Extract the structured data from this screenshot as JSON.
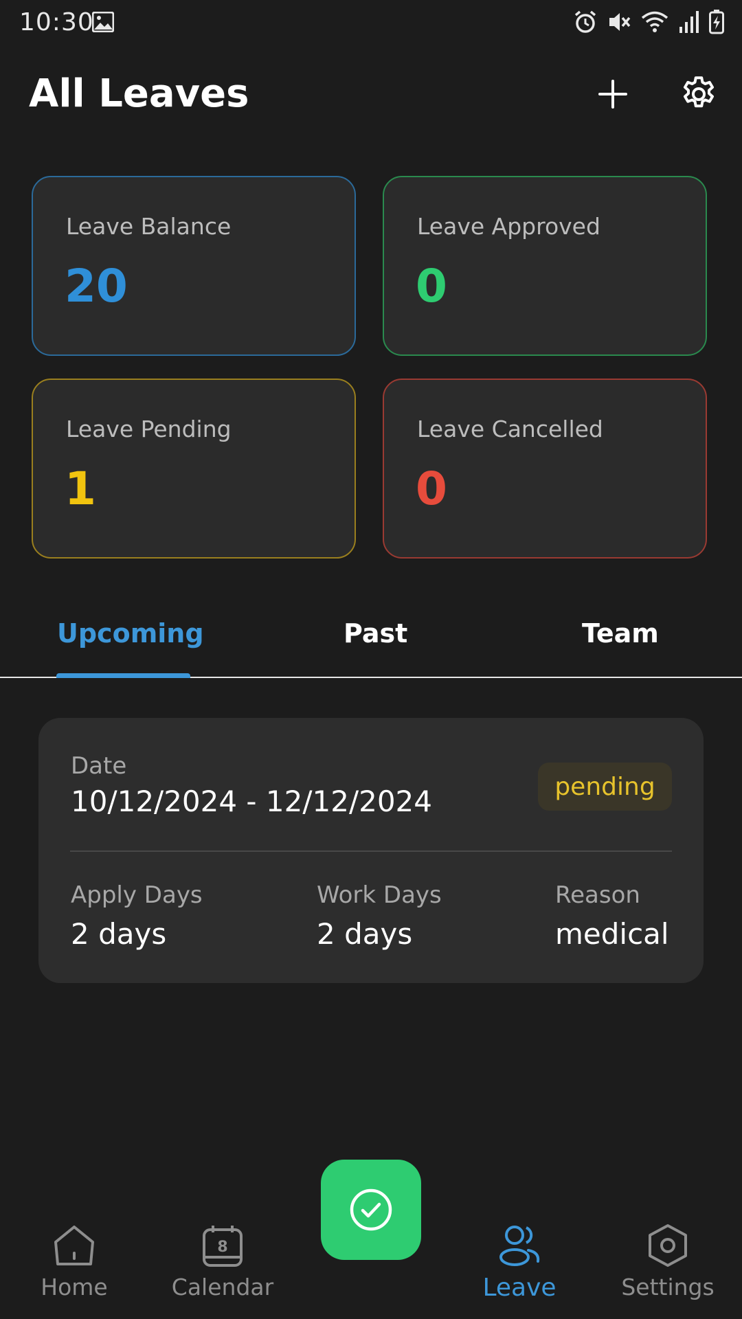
{
  "status_bar": {
    "time": "10:30"
  },
  "header": {
    "title": "All Leaves"
  },
  "stats": [
    {
      "label": "Leave Balance",
      "value": "20",
      "color": "#2f8fd8",
      "border": "#2b6a9a"
    },
    {
      "label": "Leave Approved",
      "value": "0",
      "color": "#2ecc71",
      "border": "#2a8a4e"
    },
    {
      "label": "Leave Pending",
      "value": "1",
      "color": "#f1c40f",
      "border": "#9a7f1e"
    },
    {
      "label": "Leave Cancelled",
      "value": "0",
      "color": "#e74c3c",
      "border": "#9a3a32"
    }
  ],
  "tabs": [
    {
      "label": "Upcoming",
      "active": true
    },
    {
      "label": "Past",
      "active": false
    },
    {
      "label": "Team",
      "active": false
    }
  ],
  "leave_card": {
    "date_label": "Date",
    "date_value": "10/12/2024 - 12/12/2024",
    "status": "pending",
    "apply_days_label": "Apply Days",
    "apply_days_value": "2 days",
    "work_days_label": "Work Days",
    "work_days_value": "2 days",
    "reason_label": "Reason",
    "reason_value": "medical"
  },
  "bottom_nav": [
    {
      "label": "Home",
      "icon": "home-icon",
      "active": false
    },
    {
      "label": "Calendar",
      "icon": "calendar-icon",
      "active": false,
      "badge": "8"
    },
    {
      "label": "Leave",
      "icon": "people-icon",
      "active": true
    },
    {
      "label": "Settings",
      "icon": "hexagon-settings-icon",
      "active": false
    }
  ],
  "fab": {
    "icon": "check-circle-icon"
  },
  "colors": {
    "background": "#1c1c1c",
    "card": "#2b2b2b",
    "accent": "#3d97d9",
    "fab": "#2ecc71",
    "pending_text": "#e7c32c"
  }
}
